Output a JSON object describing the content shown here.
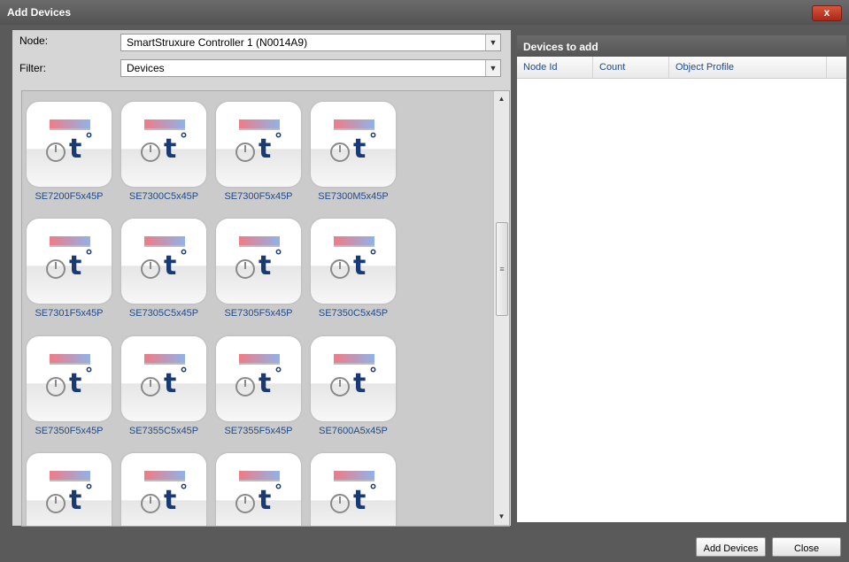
{
  "window": {
    "title": "Add Devices",
    "close_glyph": "x"
  },
  "form": {
    "node_label": "Node:",
    "node_value": "SmartStruxure Controller 1 (N0014A9)",
    "filter_label": "Filter:",
    "filter_value": "Devices"
  },
  "devices": [
    "SE7200F5x45P",
    "SE7300C5x45P",
    "SE7300F5x45P",
    "SE7300M5x45P",
    "SE7301F5x45P",
    "SE7305C5x45P",
    "SE7305F5x45P",
    "SE7350C5x45P",
    "SE7350F5x45P",
    "SE7355C5x45P",
    "SE7355F5x45P",
    "SE7600A5x45P"
  ],
  "partial_row_count": 4,
  "devices_to_add": {
    "title": "Devices to add",
    "columns": [
      "Node Id",
      "Count",
      "Object Profile"
    ],
    "rows": []
  },
  "buttons": {
    "add_devices": "Add Devices",
    "close": "Close"
  },
  "icons": {
    "thermostat": "thermostat-icon",
    "t_glyph": "t",
    "deg_glyph": "°"
  }
}
